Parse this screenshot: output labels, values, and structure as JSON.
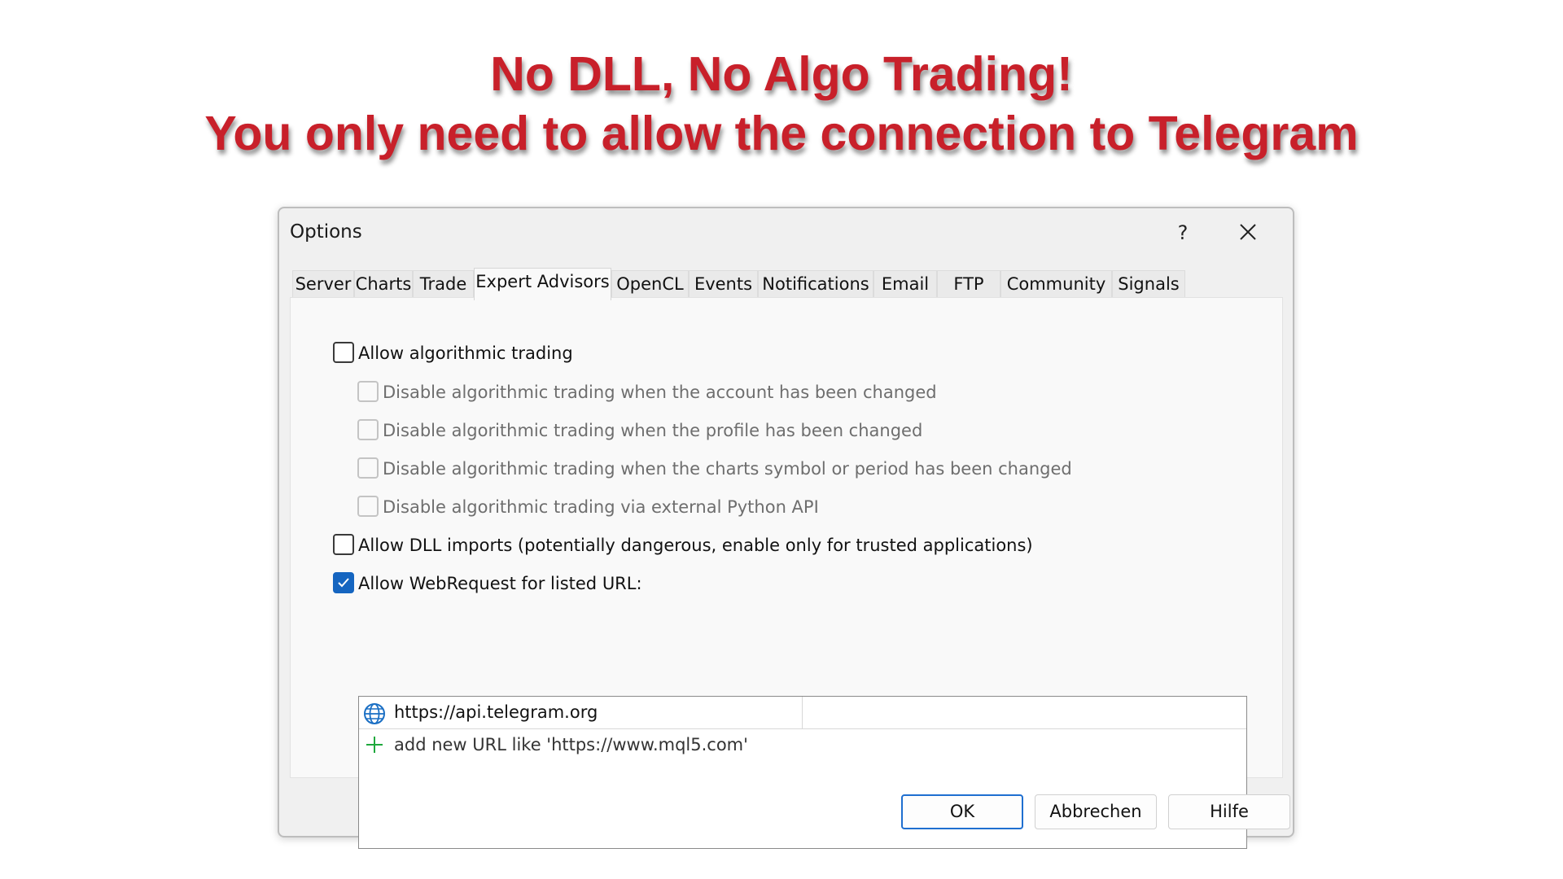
{
  "headline": {
    "line1": "No DLL, No Algo Trading!",
    "line2": "You only need to allow the connection to Telegram"
  },
  "dialog": {
    "title": "Options",
    "help_label": "?",
    "close_icon": "close-icon"
  },
  "tabs": [
    {
      "label": "Server"
    },
    {
      "label": "Charts"
    },
    {
      "label": "Trade"
    },
    {
      "label": "Expert Advisors",
      "active": true
    },
    {
      "label": "OpenCL"
    },
    {
      "label": "Events"
    },
    {
      "label": "Notifications"
    },
    {
      "label": "Email"
    },
    {
      "label": "FTP"
    },
    {
      "label": "Community"
    },
    {
      "label": "Signals"
    }
  ],
  "options": {
    "allow_algo": {
      "label": "Allow algorithmic trading",
      "checked": false
    },
    "disable_account": {
      "label": "Disable algorithmic trading when the account has been changed",
      "checked": false,
      "enabled": false
    },
    "disable_profile": {
      "label": "Disable algorithmic trading when the profile has been changed",
      "checked": false,
      "enabled": false
    },
    "disable_symbol": {
      "label": "Disable algorithmic trading when the charts symbol or period has been changed",
      "checked": false,
      "enabled": false
    },
    "disable_python": {
      "label": "Disable algorithmic trading via external Python API",
      "checked": false,
      "enabled": false
    },
    "allow_dll": {
      "label": "Allow DLL imports (potentially dangerous, enable only for trusted applications)",
      "checked": false
    },
    "allow_webrequest": {
      "label": "Allow WebRequest for listed URL:",
      "checked": true
    }
  },
  "url_list": {
    "urls": [
      "https://api.telegram.org"
    ],
    "add_placeholder": "add new URL like 'https://www.mql5.com'"
  },
  "buttons": {
    "ok": "OK",
    "cancel": "Abbrechen",
    "help": "Hilfe"
  },
  "colors": {
    "headline": "#c8202a",
    "checkbox_checked": "#1565c0",
    "ok_border": "#1f6fd0",
    "plus": "#1ea83c"
  }
}
